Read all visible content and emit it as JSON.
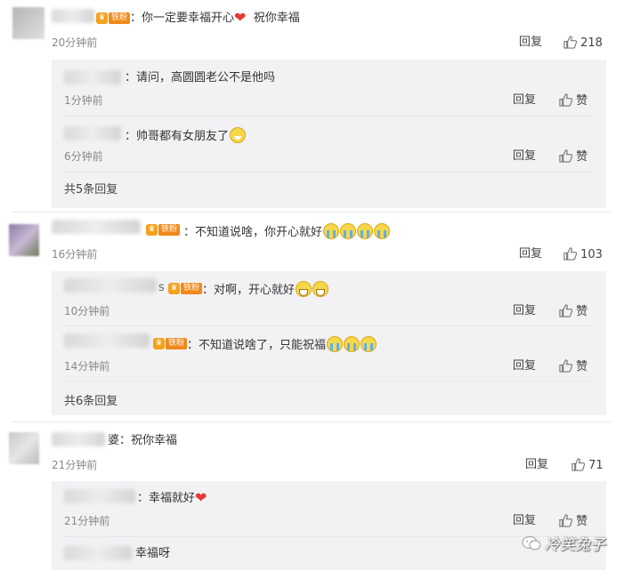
{
  "comments": [
    {
      "badge": "铁粉",
      "text": "：你一定要幸福开心",
      "text_suffix": "祝你幸福",
      "time": "20分钟前",
      "reply_label": "回复",
      "likes": "218",
      "replies": [
        {
          "text": "：请问，高圆圆老公不是他吗",
          "time": "1分钟前",
          "reply_label": "回复",
          "like_label": "赞"
        },
        {
          "text": "：帅哥都有女朋友了",
          "time": "6分钟前",
          "reply_label": "回复",
          "like_label": "赞"
        }
      ],
      "reply_count": "共5条回复"
    },
    {
      "badge": "铁粉",
      "text": "：不知道说啥，你开心就好",
      "time": "16分钟前",
      "reply_label": "回复",
      "likes": "103",
      "replies": [
        {
          "prefix": "s",
          "badge": "铁粉",
          "text": "：对啊，开心就好",
          "time": "10分钟前",
          "reply_label": "回复",
          "like_label": "赞"
        },
        {
          "badge": "铁粉",
          "text": "：不知道说啥了，只能祝福",
          "time": "14分钟前",
          "reply_label": "回复",
          "like_label": "赞"
        }
      ],
      "reply_count": "共6条回复"
    },
    {
      "text": "婆：祝你幸福",
      "time": "21分钟前",
      "reply_label": "回复",
      "likes": "71",
      "replies": [
        {
          "text": "：幸福就好",
          "time": "21分钟前",
          "reply_label": "回复",
          "like_label": "赞"
        },
        {
          "text": "幸福呀"
        }
      ]
    }
  ],
  "watermark": {
    "text": "冷笑兔子",
    "icon": "wechat-icon"
  },
  "colors": {
    "badge": "#f08a1c",
    "heart": "#e53935",
    "reply_bg": "#f2f2f5"
  }
}
